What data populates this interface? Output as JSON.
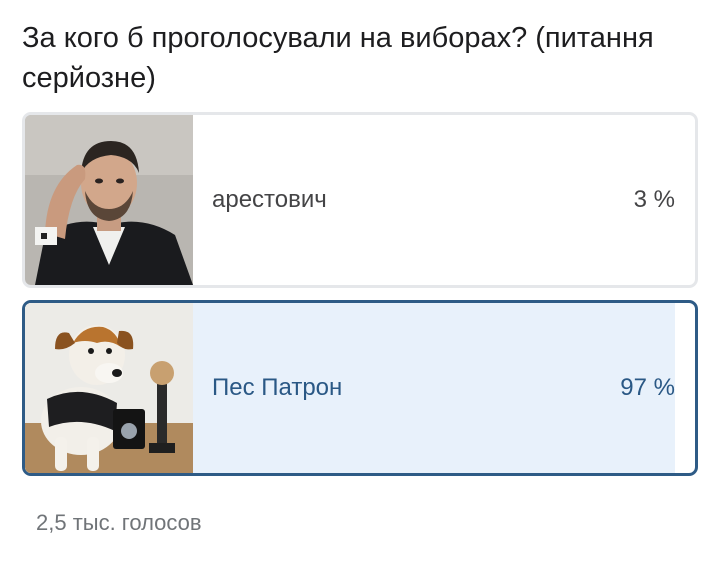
{
  "poll": {
    "question": "За кого б проголосували на виборах? (питання серйозне)",
    "options": [
      {
        "label": "арестович",
        "percent_text": "3 %",
        "share": 0.03,
        "selected": false,
        "photo": "man-portrait-photo"
      },
      {
        "label": "Пес Патрон",
        "percent_text": "97 %",
        "share": 0.97,
        "selected": true,
        "photo": "dog-patron-photo"
      }
    ],
    "votes_text": "2,5 тыс. голосов"
  },
  "colors": {
    "selected_border": "#2e5b86",
    "selected_text": "#2a5885",
    "selected_fill": "#e8f1fb",
    "default_border": "#e5e7ea",
    "default_fill": "#f1f3f5",
    "text": "#444446",
    "muted_text": "#707478"
  }
}
